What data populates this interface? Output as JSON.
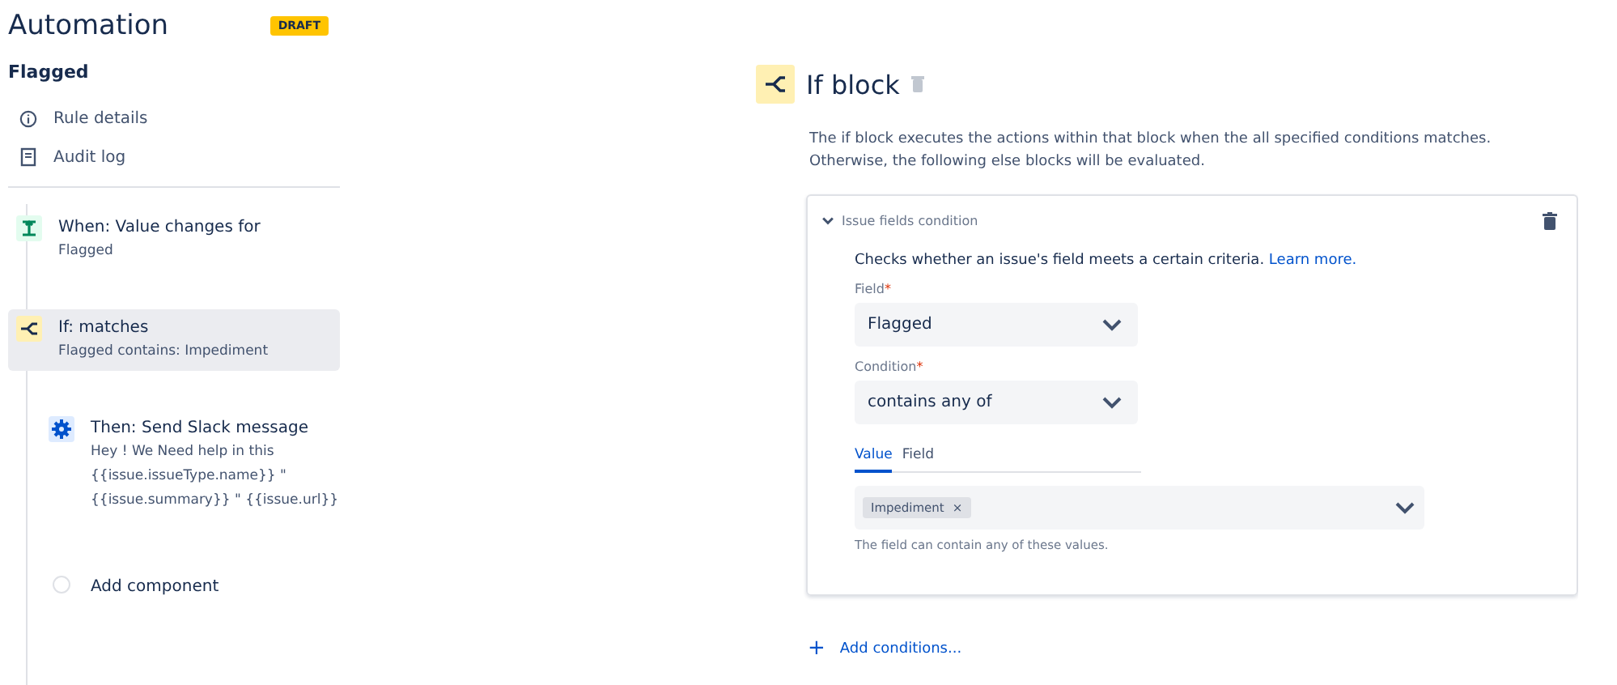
{
  "sidebar": {
    "title": "Automation",
    "badge": "DRAFT",
    "rule_name": "Flagged",
    "links": [
      {
        "kind": "info",
        "label": "Rule details"
      },
      {
        "kind": "log",
        "label": "Audit log"
      }
    ],
    "steps": [
      {
        "kind": "trigger",
        "title": "When: Value changes for",
        "lines": [
          "Flagged"
        ],
        "selected": false
      },
      {
        "kind": "condition",
        "title": "If: matches",
        "lines": [
          "Flagged contains: Impediment"
        ],
        "selected": true
      },
      {
        "kind": "action",
        "title": "Then: Send Slack message",
        "lines": [
          "Hey ! We Need help in this",
          "{{issue.issueType.name}} \"",
          "{{issue.summary}} \" {{issue.url}}"
        ],
        "selected": false
      },
      {
        "kind": "add",
        "title": "Add component",
        "selected": false
      }
    ]
  },
  "panel": {
    "title": "If block",
    "description": "The if block executes the actions within that block when the all specified conditions matches.\nOtherwise, the following else blocks will be evaluated.",
    "condition": {
      "title": "Issue fields condition",
      "expanded": true,
      "intro": "Checks whether an issue's field meets a certain criteria.",
      "link": "Learn more.",
      "fields": [
        {
          "label": "Field",
          "required_mark": "*",
          "value": "Flagged"
        },
        {
          "label": "Condition",
          "required_mark": "*",
          "value": "contains any of"
        }
      ],
      "tabs": [
        {
          "label": "Value",
          "selected": true
        },
        {
          "label": "Field",
          "selected": false
        }
      ],
      "values": [
        {
          "label": "Impediment",
          "remove": "×"
        }
      ],
      "helper": "The field can contain any of these values."
    },
    "add_conditions": {
      "icon": "+",
      "label": "Add conditions..."
    }
  }
}
